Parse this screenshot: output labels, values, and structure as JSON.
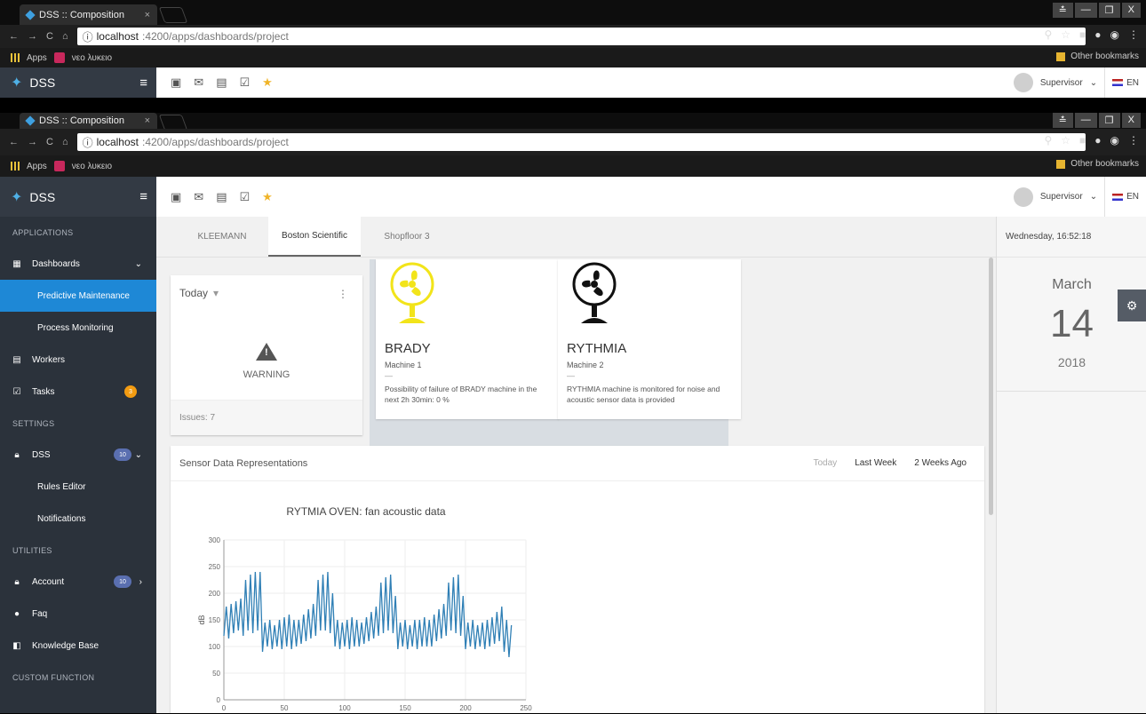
{
  "browser": {
    "tab_title": "DSS :: Composition",
    "tab_close": "×",
    "url_host": "localhost",
    "url_path": ":4200/apps/dashboards/project",
    "bookmarks": {
      "apps": "Apps",
      "item": "νεο λυκειο",
      "other": "Other bookmarks"
    },
    "window_controls": [
      "≛",
      "—",
      "❐",
      "X"
    ]
  },
  "header": {
    "brand": "DSS",
    "user": "Supervisor",
    "lang": "EN"
  },
  "sidebar": {
    "sections": {
      "applications": "APPLICATIONS",
      "settings": "SETTINGS",
      "utilities": "UTILITIES",
      "custom": "CUSTOM FUNCTION"
    },
    "items": {
      "dashboards": "Dashboards",
      "predictive": "Predictive Maintenance",
      "process": "Process Monitoring",
      "workers": "Workers",
      "tasks": "Tasks",
      "tasks_badge": "3",
      "dss": "DSS",
      "dss_badge": "10",
      "rules": "Rules Editor",
      "notifications": "Notifications",
      "account": "Account",
      "account_badge": "10",
      "faq": "Faq",
      "kb": "Knowledge Base"
    }
  },
  "tabs": [
    "KLEEMANN",
    "Boston Scientific",
    "Shopfloor 3"
  ],
  "today_card": {
    "period": "Today",
    "status": "WARNING",
    "issues": "Issues: 7"
  },
  "machines": [
    {
      "name": "BRADY",
      "label": "Machine 1",
      "dash": "—",
      "desc": "Possibility of failure of BRADY machine in the next 2h 30min: 0 %",
      "color": "#f2e41a"
    },
    {
      "name": "RYTHMIA",
      "label": "Machine 2",
      "dash": "—",
      "desc": "RYTHMIA machine is monitored for noise and acoustic sensor data is provided",
      "color": "#111111"
    }
  ],
  "sensor": {
    "title": "Sensor Data Representations",
    "ranges": [
      "Today",
      "Last Week",
      "2 Weeks Ago"
    ]
  },
  "chart_data": {
    "type": "line",
    "title": "RYTMIA OVEN: fan acoustic data",
    "xlabel": "",
    "ylabel": "dB",
    "xlim": [
      0,
      250
    ],
    "ylim": [
      0,
      300
    ],
    "xticks": [
      0,
      50,
      100,
      150,
      200,
      250
    ],
    "yticks": [
      0,
      50,
      100,
      150,
      200,
      250,
      300
    ],
    "grid": true,
    "series": [
      {
        "color": "#2f7fb5",
        "x": [
          0,
          2,
          4,
          6,
          8,
          10,
          12,
          14,
          16,
          18,
          20,
          22,
          24,
          26,
          28,
          30,
          32,
          34,
          36,
          38,
          40,
          42,
          44,
          46,
          48,
          50,
          52,
          54,
          56,
          58,
          60,
          62,
          64,
          66,
          68,
          70,
          72,
          74,
          76,
          78,
          80,
          82,
          84,
          86,
          88,
          90,
          92,
          94,
          96,
          98,
          100,
          102,
          104,
          106,
          108,
          110,
          112,
          114,
          116,
          118,
          120,
          122,
          124,
          126,
          128,
          130,
          132,
          134,
          136,
          138,
          140,
          142,
          144,
          146,
          148,
          150,
          152,
          154,
          156,
          158,
          160,
          162,
          164,
          166,
          168,
          170,
          172,
          174,
          176,
          178,
          180,
          182,
          184,
          186,
          188,
          190,
          192,
          194,
          196,
          198,
          200,
          202,
          204,
          206,
          208,
          210,
          212,
          214,
          216,
          218,
          220,
          222,
          224,
          226,
          228,
          230,
          232,
          234,
          236,
          238
        ],
        "values": [
          120,
          175,
          115,
          180,
          125,
          185,
          130,
          190,
          120,
          225,
          130,
          235,
          125,
          240,
          130,
          240,
          90,
          145,
          100,
          150,
          95,
          140,
          100,
          150,
          95,
          155,
          100,
          160,
          95,
          150,
          100,
          150,
          105,
          160,
          110,
          170,
          115,
          180,
          120,
          225,
          130,
          235,
          130,
          240,
          125,
          200,
          100,
          150,
          95,
          145,
          100,
          150,
          95,
          155,
          100,
          150,
          100,
          145,
          105,
          155,
          110,
          165,
          115,
          175,
          120,
          220,
          125,
          230,
          130,
          235,
          125,
          195,
          95,
          145,
          100,
          150,
          95,
          140,
          100,
          150,
          95,
          150,
          100,
          155,
          100,
          150,
          100,
          160,
          110,
          170,
          115,
          180,
          120,
          220,
          130,
          230,
          125,
          235,
          120,
          195,
          95,
          145,
          100,
          150,
          95,
          140,
          100,
          145,
          95,
          150,
          100,
          155,
          105,
          165,
          110,
          175,
          90,
          150,
          80,
          140
        ]
      }
    ]
  }
}
